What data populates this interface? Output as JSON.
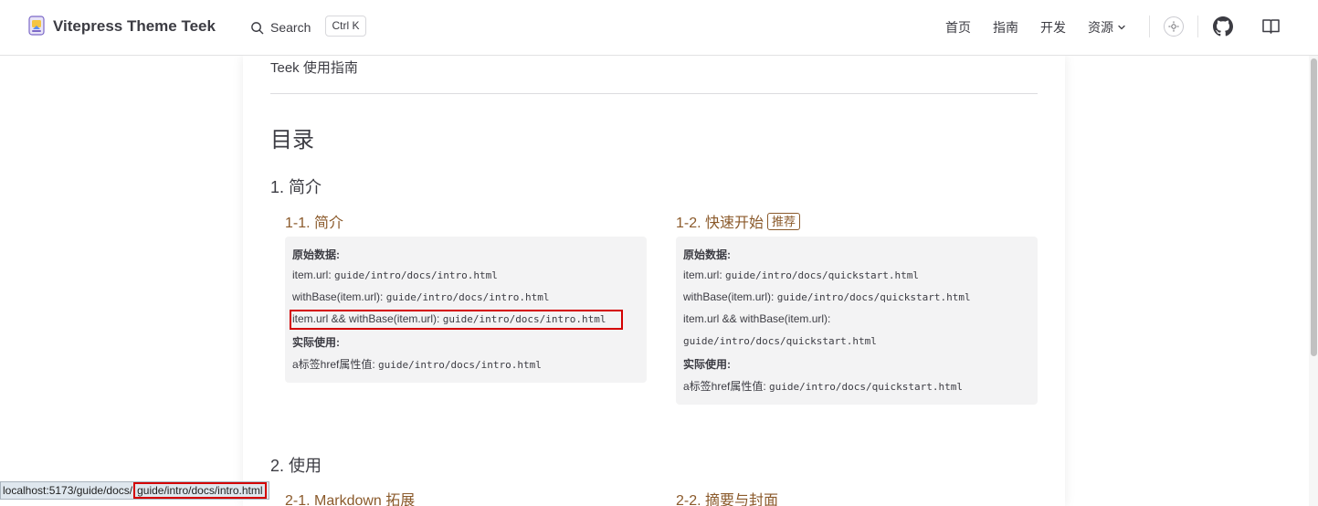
{
  "header": {
    "site_title": "Vitepress Theme Teek",
    "search_label": "Search",
    "search_shortcut": "Ctrl K",
    "nav": {
      "home": "首页",
      "guide": "指南",
      "dev": "开发",
      "resources": "资源"
    },
    "icons": [
      "logo-icon",
      "search-icon",
      "chevron-down-icon",
      "theme-toggle-icon",
      "github-icon",
      "book-icon"
    ]
  },
  "content": {
    "intro": "Teek 使用指南",
    "toc_title": "目录",
    "section1": {
      "title": "1. 简介",
      "left": {
        "title": "1-1. 简介",
        "raw_label": "原始数据:",
        "url_label": "item.url:",
        "url_value": "guide/intro/docs/intro.html",
        "withbase_label": "withBase(item.url):",
        "withbase_value": "guide/intro/docs/intro.html",
        "combo_label": "item.url && withBase(item.url):",
        "combo_value": "guide/intro/docs/intro.html",
        "actual_label": "实际使用:",
        "href_label": "a标签href属性值:",
        "href_value": "guide/intro/docs/intro.html"
      },
      "right": {
        "title": "1-2. 快速开始",
        "badge": "推荐",
        "raw_label": "原始数据:",
        "url_label": "item.url:",
        "url_value": "guide/intro/docs/quickstart.html",
        "withbase_label": "withBase(item.url):",
        "withbase_value": "guide/intro/docs/quickstart.html",
        "combo_label": "item.url && withBase(item.url):",
        "combo_value": "guide/intro/docs/quickstart.html",
        "actual_label": "实际使用:",
        "href_label": "a标签href属性值:",
        "href_value": "guide/intro/docs/quickstart.html"
      }
    },
    "section2": {
      "title": "2. 使用",
      "left_title": "2-1. Markdown 拓展",
      "right_title": "2-2. 摘要与封面"
    }
  },
  "statusbar": {
    "prefix": "localhost:5173/guide/docs/",
    "highlight": "guide/intro/docs/intro.html"
  },
  "colors": {
    "accent": "#8b5a2b",
    "highlight_box": "#d40000",
    "panel_bg": "#f3f3f4"
  }
}
